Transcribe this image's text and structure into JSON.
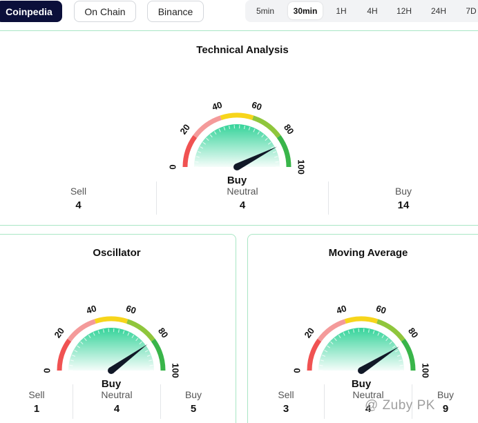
{
  "sources": [
    {
      "label": "Coinpedia",
      "active": true
    },
    {
      "label": "On Chain",
      "active": false
    },
    {
      "label": "Binance",
      "active": false
    }
  ],
  "timeframes": [
    {
      "label": "5min",
      "active": false
    },
    {
      "label": "30min",
      "active": true
    },
    {
      "label": "1H",
      "active": false
    },
    {
      "label": "4H",
      "active": false
    },
    {
      "label": "12H",
      "active": false
    },
    {
      "label": "24H",
      "active": false
    },
    {
      "label": "7D",
      "active": false
    }
  ],
  "gauge_ticks": [
    "0",
    "20",
    "40",
    "60",
    "80",
    "100"
  ],
  "colors": {
    "red": "#f05252",
    "pink": "#f49a9a",
    "yellow": "#f7d51b",
    "lightgreen": "#8fc63c",
    "green": "#39b54a",
    "card_border": "#a8e6c4",
    "fill_green": "#34d399"
  },
  "technical_analysis": {
    "title": "Technical Analysis",
    "verdict": "Buy",
    "needle_value": 85,
    "stats": [
      {
        "label": "Sell",
        "value": "4"
      },
      {
        "label": "Neutral",
        "value": "4"
      },
      {
        "label": "Buy",
        "value": "14"
      }
    ]
  },
  "oscillator": {
    "title": "Oscillator",
    "verdict": "Buy",
    "needle_value": 80,
    "stats": [
      {
        "label": "Sell",
        "value": "1"
      },
      {
        "label": "Neutral",
        "value": "4"
      },
      {
        "label": "Buy",
        "value": "5"
      }
    ]
  },
  "moving_average": {
    "title": "Moving Average",
    "verdict": "Buy",
    "needle_value": 82,
    "stats": [
      {
        "label": "Sell",
        "value": "3"
      },
      {
        "label": "Neutral",
        "value": "4"
      },
      {
        "label": "Buy",
        "value": "9"
      }
    ]
  },
  "watermark": "@ Zuby PK"
}
